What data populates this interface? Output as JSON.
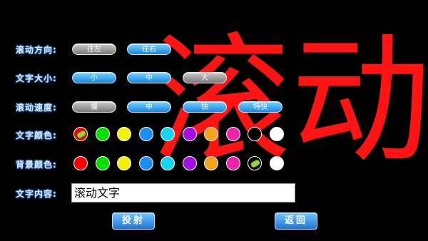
{
  "preview_text": "滚动",
  "labels": {
    "direction": "滚动方向:",
    "size": "文字大小:",
    "speed": "滚动速度:",
    "text_color": "文字颜色:",
    "bg_color": "背景颜色:",
    "content": "文字内容:"
  },
  "direction": {
    "left": "往左",
    "right": "往右",
    "selected": "往左"
  },
  "size": {
    "small": "小",
    "medium": "中",
    "large": "大",
    "selected": "大"
  },
  "speed": {
    "slow": "慢",
    "medium": "中",
    "fast": "快",
    "very_fast": "特快",
    "selected": "慢"
  },
  "palette": [
    "#ff0000",
    "#00e000",
    "#f2f200",
    "#1a8ef2",
    "#12d6f2",
    "#a40ce8",
    "#f2a41a",
    "#ee22a8",
    "#000000",
    "#ffffff"
  ],
  "text_color_selected_index": 0,
  "bg_color_selected_index": 8,
  "content_value": "滚动文字",
  "buttons": {
    "submit": "投射",
    "back": "返回"
  }
}
